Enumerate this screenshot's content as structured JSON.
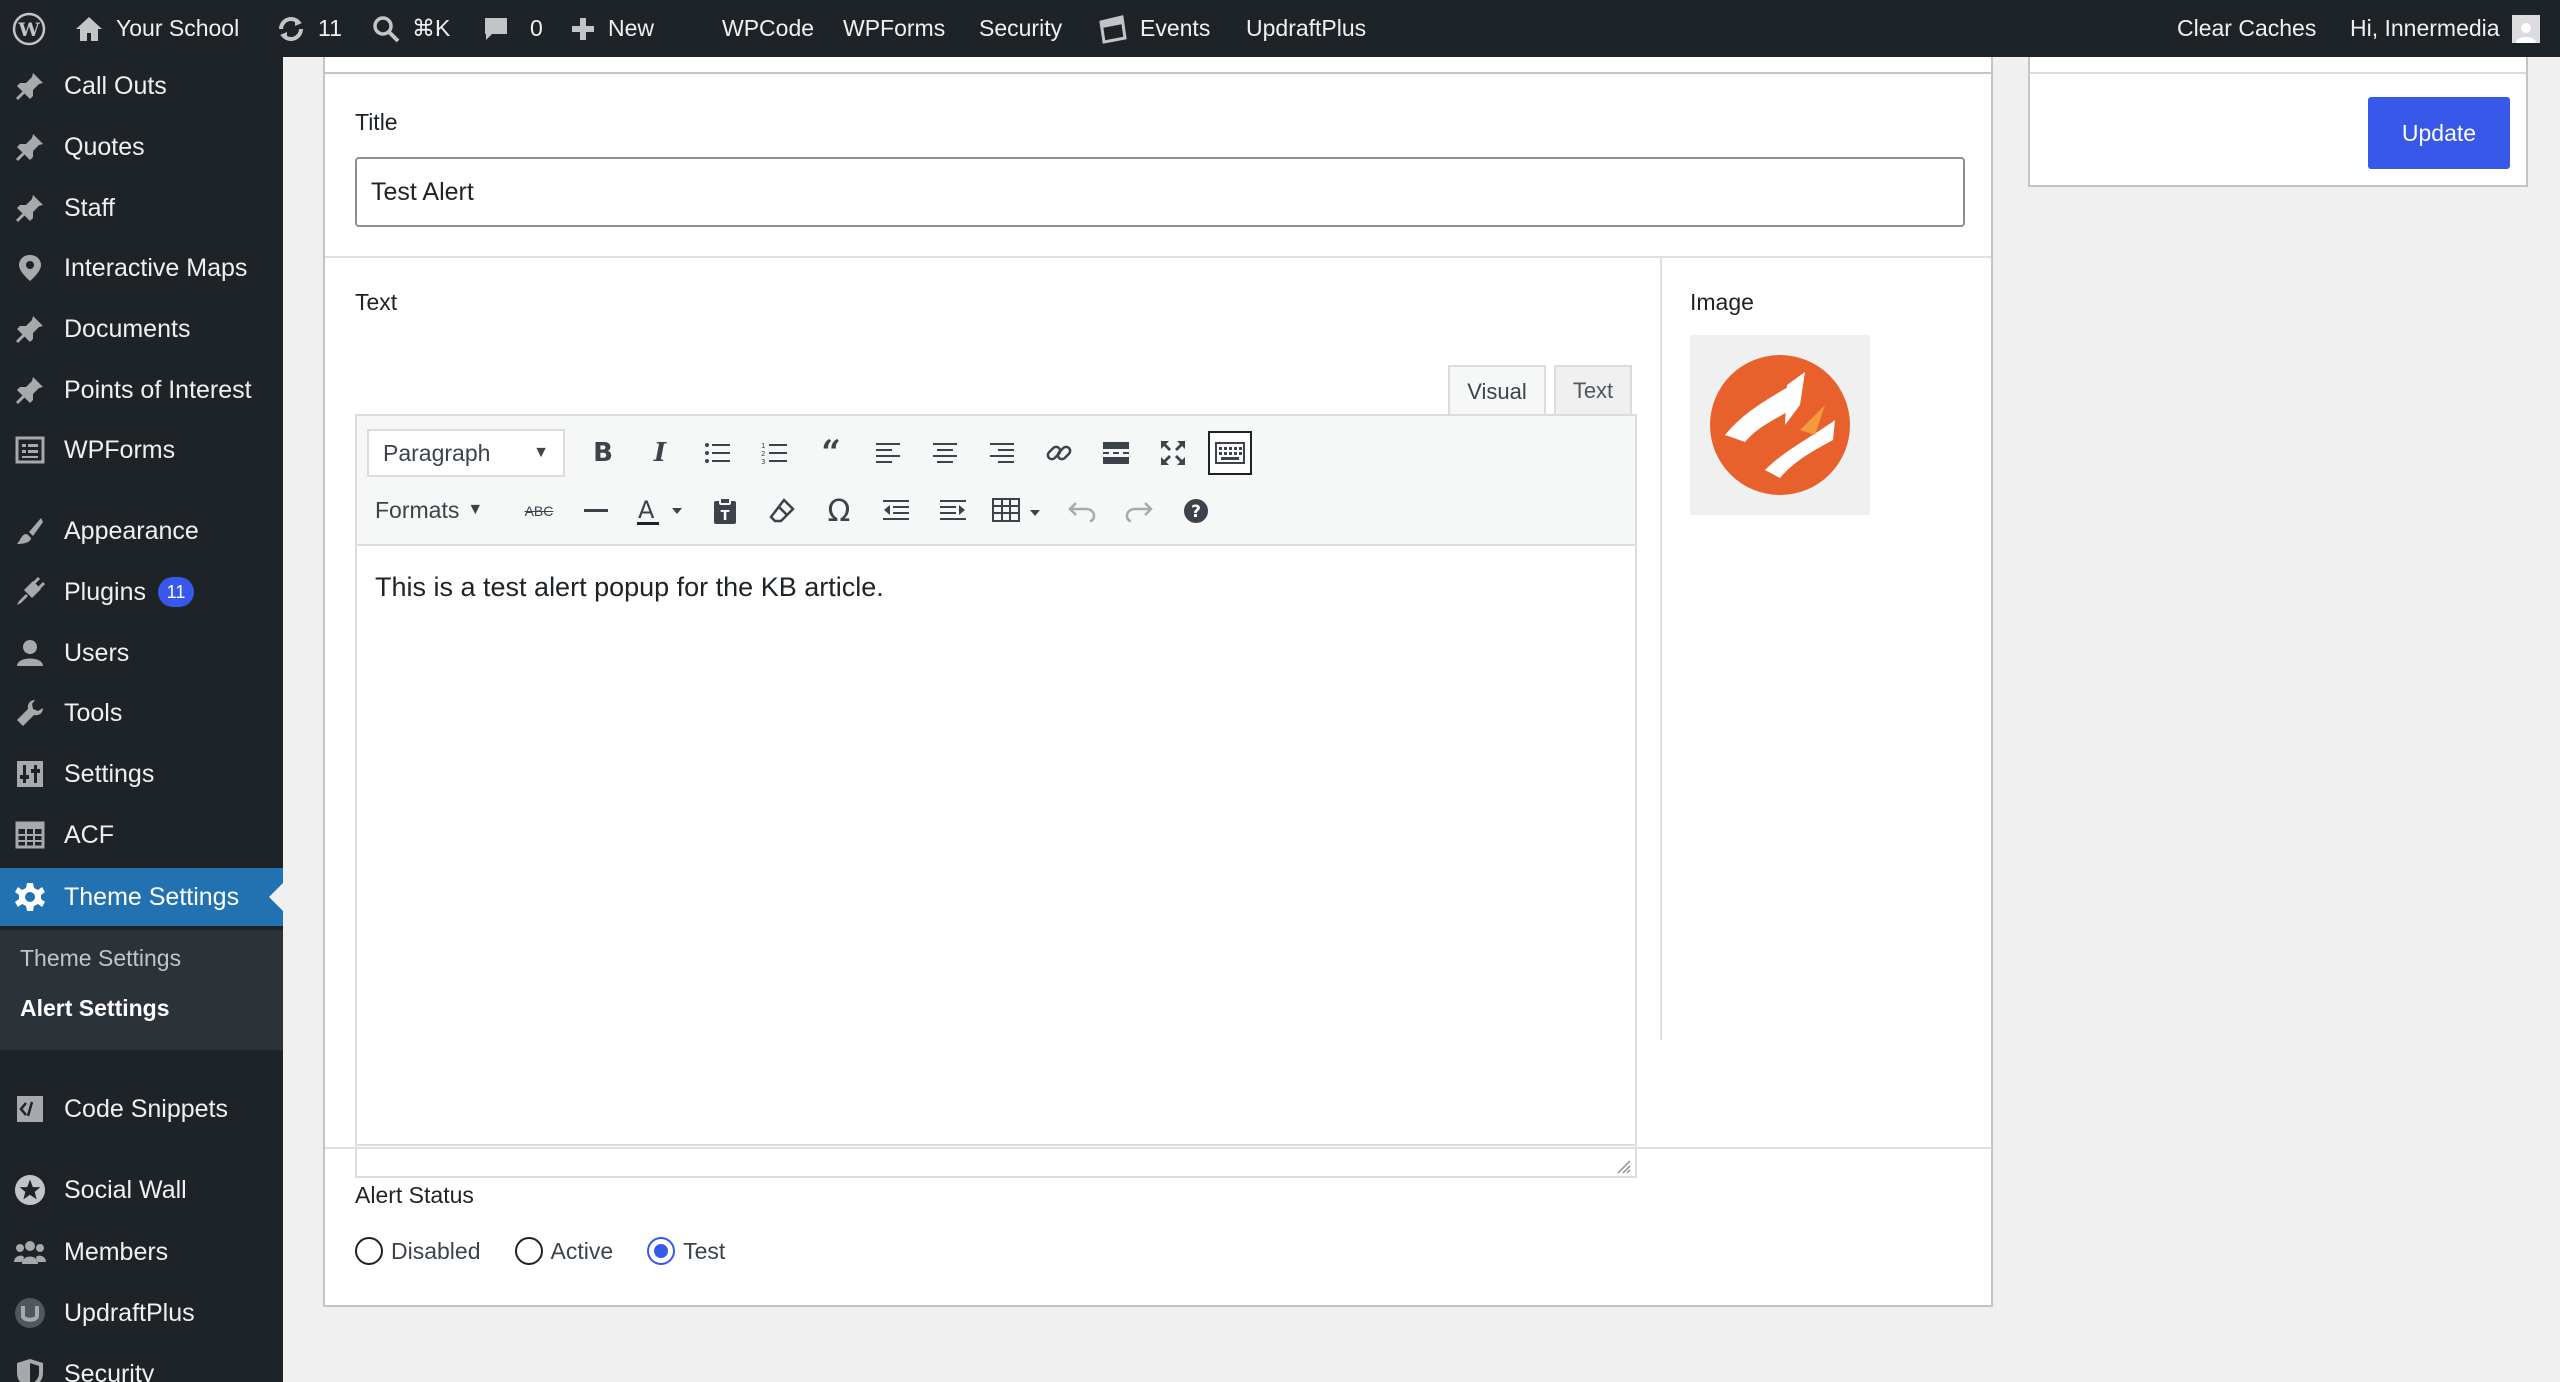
{
  "adminbar": {
    "site_name": "Your School",
    "updates_count": "11",
    "search_shortcut": "⌘K",
    "comments_count": "0",
    "new_label": "New",
    "links": [
      "WPCode",
      "WPForms",
      "Security"
    ],
    "events_label": "Events",
    "updraft_label": "UpdraftPlus",
    "clear_caches": "Clear Caches",
    "greeting": "Hi, Innermedia"
  },
  "sidebar": {
    "items": [
      {
        "label": "Call Outs",
        "icon": "pin-icon"
      },
      {
        "label": "Quotes",
        "icon": "pin-icon"
      },
      {
        "label": "Staff",
        "icon": "pin-icon"
      },
      {
        "label": "Interactive Maps",
        "icon": "location-icon"
      },
      {
        "label": "Documents",
        "icon": "pin-icon"
      },
      {
        "label": "Points of Interest",
        "icon": "pin-icon"
      },
      {
        "label": "WPForms",
        "icon": "forms-icon"
      },
      {
        "label": "Appearance",
        "icon": "brush-icon"
      },
      {
        "label": "Plugins",
        "icon": "plugin-icon",
        "badge": "11"
      },
      {
        "label": "Users",
        "icon": "user-icon"
      },
      {
        "label": "Tools",
        "icon": "wrench-icon"
      },
      {
        "label": "Settings",
        "icon": "settings-icon"
      },
      {
        "label": "ACF",
        "icon": "table-icon"
      },
      {
        "label": "Theme Settings",
        "icon": "gear-icon"
      },
      {
        "label": "Code Snippets",
        "icon": "code-icon"
      },
      {
        "label": "Social Wall",
        "icon": "social-icon"
      },
      {
        "label": "Members",
        "icon": "members-icon"
      },
      {
        "label": "UpdraftPlus",
        "icon": "updraft-icon"
      },
      {
        "label": "Security",
        "icon": "shield-icon"
      }
    ],
    "submenu": [
      "Theme Settings",
      "Alert Settings"
    ]
  },
  "form": {
    "title_label": "Title",
    "title_value": "Test Alert",
    "text_label": "Text",
    "image_label": "Image",
    "editor_tabs": [
      "Visual",
      "Text"
    ],
    "paragraph_select": "Paragraph",
    "formats_label": "Formats",
    "body_text": "This is a test alert popup for the KB article.",
    "status_label": "Alert Status",
    "status_options": [
      "Disabled",
      "Active",
      "Test"
    ],
    "status_selected": "Test"
  },
  "publish": {
    "update_label": "Update"
  },
  "colors": {
    "adminbar_bg": "#1d2327",
    "current_menu": "#2271b1",
    "primary_button": "#3858e9"
  }
}
